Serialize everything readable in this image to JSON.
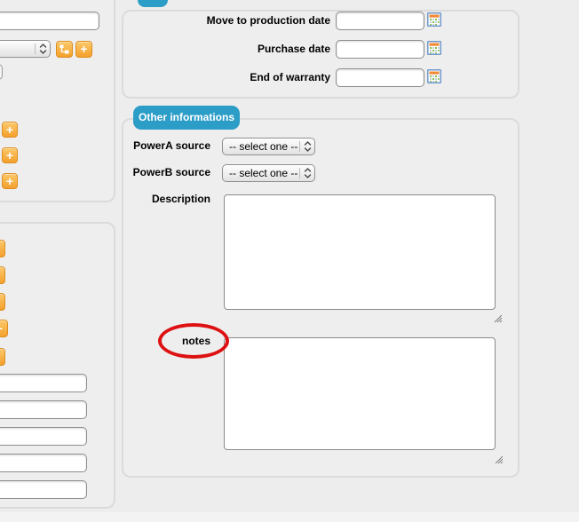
{
  "colors": {
    "accent_blue": "#2C9DC7",
    "accent_orange": "#F5A42B",
    "annotation_red": "#DD1111",
    "background": "#EDEDED"
  },
  "dates_panel": {
    "rows": [
      {
        "label": "Move to production date",
        "value": "",
        "icon": "calendar-icon"
      },
      {
        "label": "Purchase date",
        "value": "",
        "icon": "calendar-icon"
      },
      {
        "label": "End of warranty",
        "value": "",
        "icon": "calendar-icon"
      }
    ]
  },
  "other_info_panel": {
    "tab_label": "Other informations",
    "power_a": {
      "label": "PowerA source",
      "selected": "-- select one --"
    },
    "power_b": {
      "label": "PowerB source",
      "selected": "-- select one --"
    },
    "description": {
      "label": "Description",
      "value": ""
    },
    "notes": {
      "label": "notes",
      "value": "",
      "annotation": "red-ellipse"
    }
  },
  "left_panel_top": {
    "input_value": "",
    "select_value": "",
    "tree_button_icon": "tree-icon",
    "add_button_label": "+",
    "plus_buttons": [
      "+",
      "+",
      "+"
    ]
  },
  "left_panel_bottom": {
    "edge_button_label": "+",
    "input_values": [
      "",
      "",
      "",
      "",
      ""
    ]
  }
}
